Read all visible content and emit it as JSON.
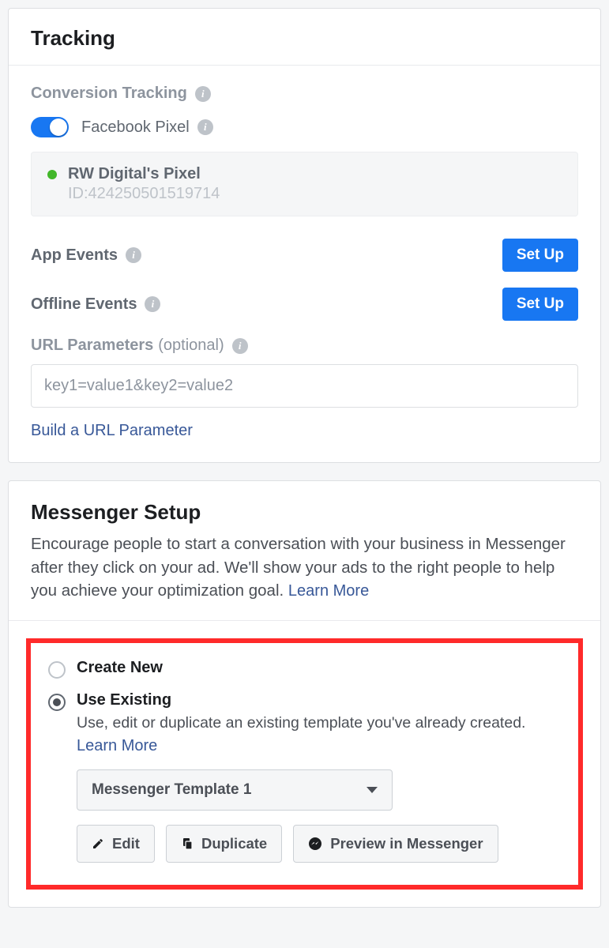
{
  "tracking": {
    "title": "Tracking",
    "conversion_label": "Conversion Tracking",
    "pixel_toggle_label": "Facebook Pixel",
    "pixel": {
      "name": "RW Digital's Pixel",
      "id_label": "ID:424250501519714"
    },
    "app_events_label": "App Events",
    "app_events_btn": "Set Up",
    "offline_events_label": "Offline Events",
    "offline_events_btn": "Set Up",
    "url_params_label": "URL Parameters",
    "url_params_optional": "(optional)",
    "url_placeholder": "key1=value1&key2=value2",
    "build_url_link": "Build a URL Parameter"
  },
  "messenger": {
    "title": "Messenger Setup",
    "description": "Encourage people to start a conversation with your business in Messenger after they click on your ad. We'll show your ads to the right people to help you achieve your optimization goal.",
    "learn_more": "Learn More",
    "create_new": "Create New",
    "use_existing": "Use Existing",
    "use_existing_desc": "Use, edit or duplicate an existing template you've already created.",
    "use_existing_learn": "Learn More",
    "selected_template": "Messenger Template 1",
    "edit_btn": "Edit",
    "duplicate_btn": "Duplicate",
    "preview_btn": "Preview in Messenger"
  }
}
